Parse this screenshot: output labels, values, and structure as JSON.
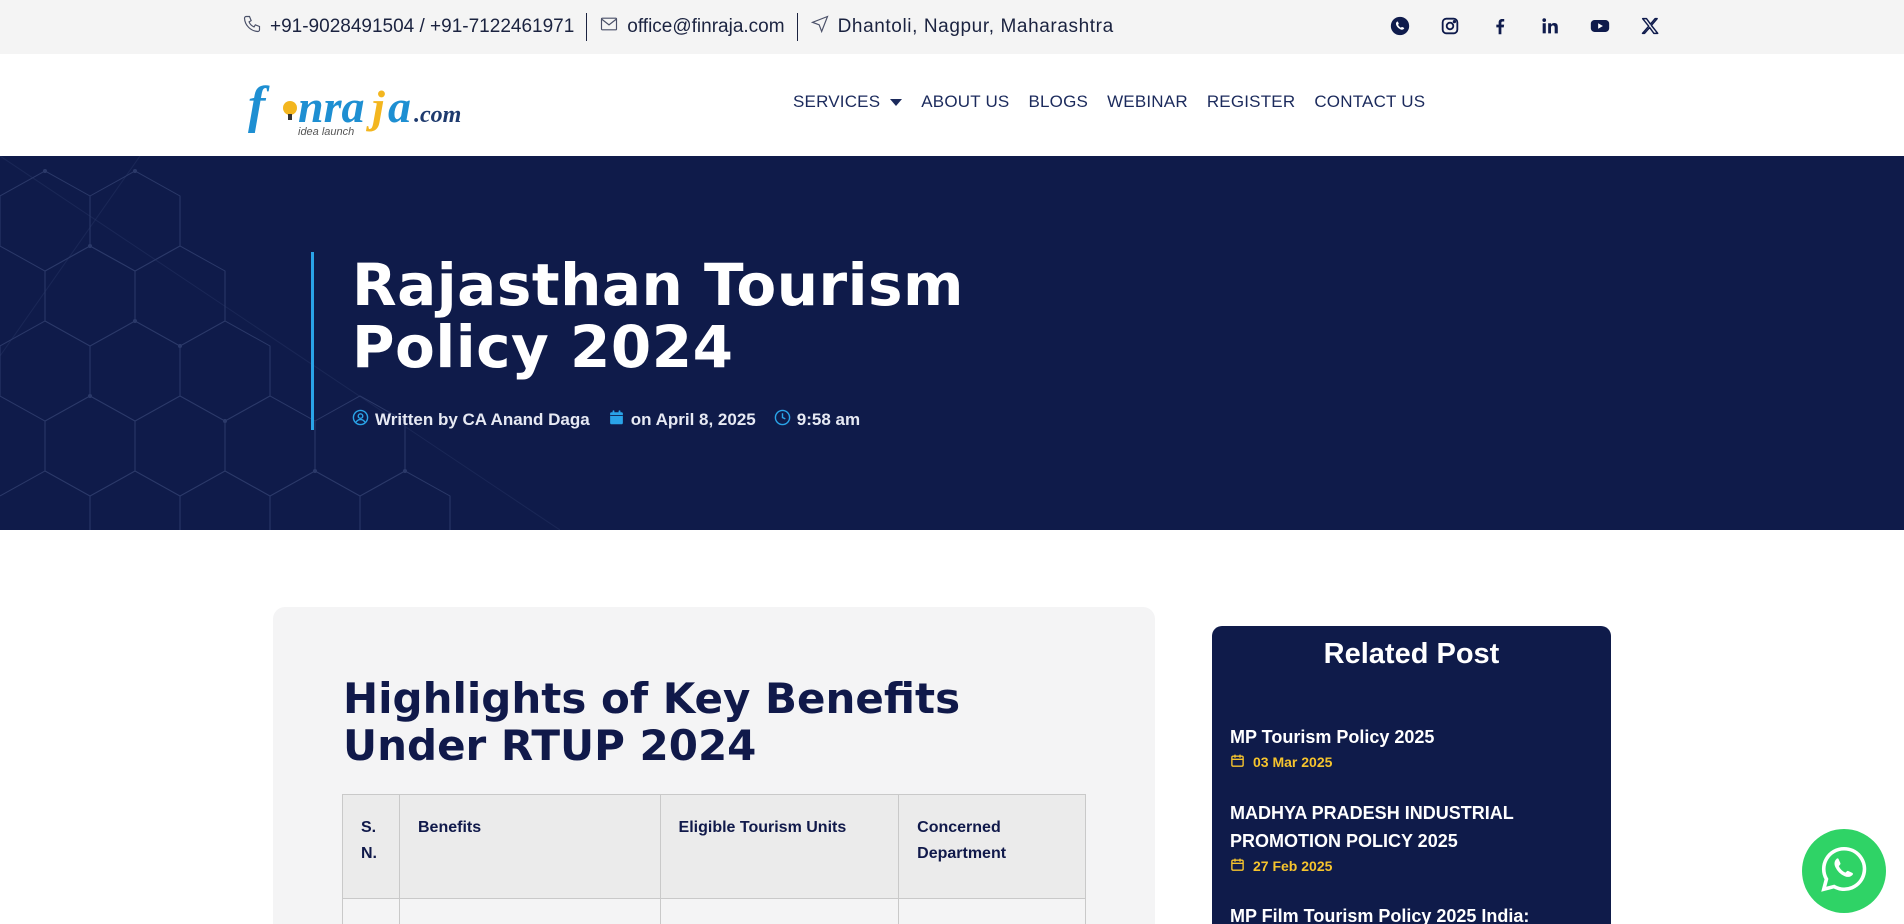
{
  "topbar": {
    "phone": "+91-9028491504 / +91-7122461971",
    "email": "office@finraja.com",
    "address": "Dhantoli, Nagpur, Maharashtra",
    "socials": [
      "whatsapp-icon",
      "instagram-icon",
      "facebook-icon",
      "linkedin-icon",
      "youtube-icon",
      "x-icon"
    ]
  },
  "header": {
    "logo_text": "finraja",
    "logo_suffix": ".com",
    "logo_tagline": "idea launch",
    "nav": {
      "services": "SERVICES",
      "about": "ABOUT US",
      "blogs": "BLOGS",
      "webinar": "WEBINAR",
      "register": "REGISTER",
      "contact": "CONTACT US"
    }
  },
  "hero": {
    "title": "Rajasthan Tourism Policy 2024",
    "author": "Written by CA Anand Daga",
    "date": "on April 8, 2025",
    "time": "9:58 am"
  },
  "article": {
    "section_title": "Highlights of Key Benefits Under RTUP 2024",
    "table_headers": [
      "S. N.",
      "Benefits",
      "Eligible Tourism Units",
      "Concerned Department"
    ]
  },
  "sidebar": {
    "title": "Related Post",
    "posts": [
      {
        "title": "MP Tourism Policy 2025",
        "date": "03 Mar 2025"
      },
      {
        "title": "MADHYA PRADESH INDUSTRIAL PROMOTION POLICY 2025",
        "date": "27 Feb 2025"
      },
      {
        "title": "MP Film Tourism Policy 2025 India:",
        "date": ""
      }
    ]
  },
  "colors": {
    "navy": "#0f1b4a",
    "accent_blue": "#2aa4e8",
    "date_yellow": "#f6c42d",
    "whatsapp_green": "#2fd366"
  }
}
